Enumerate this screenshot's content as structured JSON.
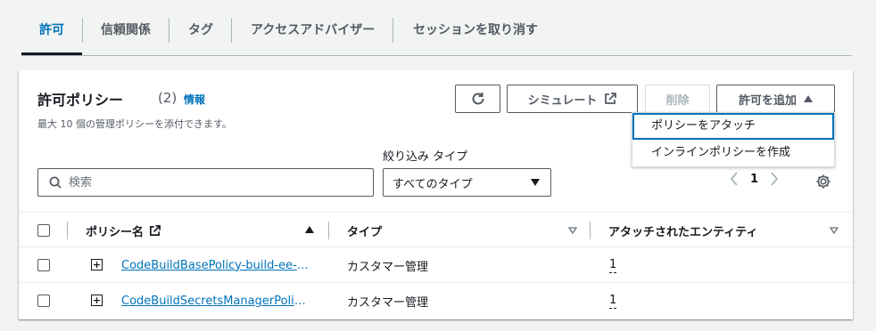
{
  "tabs": [
    {
      "label": "許可"
    },
    {
      "label": "信頼関係"
    },
    {
      "label": "タグ"
    },
    {
      "label": "アクセスアドバイザー"
    },
    {
      "label": "セッションを取り消す"
    }
  ],
  "panel": {
    "title": "許可ポリシー",
    "count": "(2)",
    "info": "情報",
    "description": "最大 10 個の管理ポリシーを添付できます。"
  },
  "toolbar": {
    "simulate_label": "シミュレート",
    "delete_label": "削除",
    "add_label": "許可を追加"
  },
  "dropdown": {
    "items": [
      {
        "label": "ポリシーをアタッチ"
      },
      {
        "label": "インラインポリシーを作成"
      }
    ]
  },
  "filter": {
    "search_placeholder": "検索",
    "type_label": "絞り込み タイプ",
    "type_value": "すべてのタイプ"
  },
  "pagination": {
    "current_page": "1"
  },
  "table": {
    "columns": [
      "ポリシー名",
      "タイプ",
      "アタッチされたエンティティ"
    ],
    "rows": [
      {
        "name": "CodeBuildBasePolicy-build-ee-i...",
        "type": "カスタマー管理",
        "entities": "1"
      },
      {
        "name": "CodeBuildSecretsManagerPolic...",
        "type": "カスタマー管理",
        "entities": "1"
      }
    ]
  },
  "colors": {
    "accent": "#0073bb",
    "text": "#16191f",
    "muted": "#545b64"
  }
}
